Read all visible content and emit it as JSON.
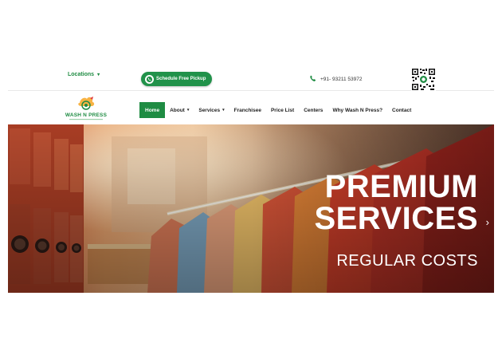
{
  "topbar": {
    "locations_label": "Locations",
    "pickup_label": "Schedule Free Pickup",
    "phone": "+91- 93211 53972"
  },
  "brand": {
    "name": "WASH N PRESS",
    "accent": "#1f8c43"
  },
  "nav": {
    "items": [
      {
        "label": "Home",
        "active": true
      },
      {
        "label": "About",
        "dropdown": true
      },
      {
        "label": "Services",
        "dropdown": true
      },
      {
        "label": "Franchisee"
      },
      {
        "label": "Price List"
      },
      {
        "label": "Centers"
      },
      {
        "label": "Why Wash N Press?"
      },
      {
        "label": "Contact"
      }
    ]
  },
  "hero": {
    "headline_line1": "PREMIUM",
    "headline_line2": "SERVICES",
    "subheadline": "REGULAR COSTS",
    "next_icon": "chevron-right-icon"
  },
  "icons": {
    "caret": "▾",
    "chevron": "›"
  }
}
